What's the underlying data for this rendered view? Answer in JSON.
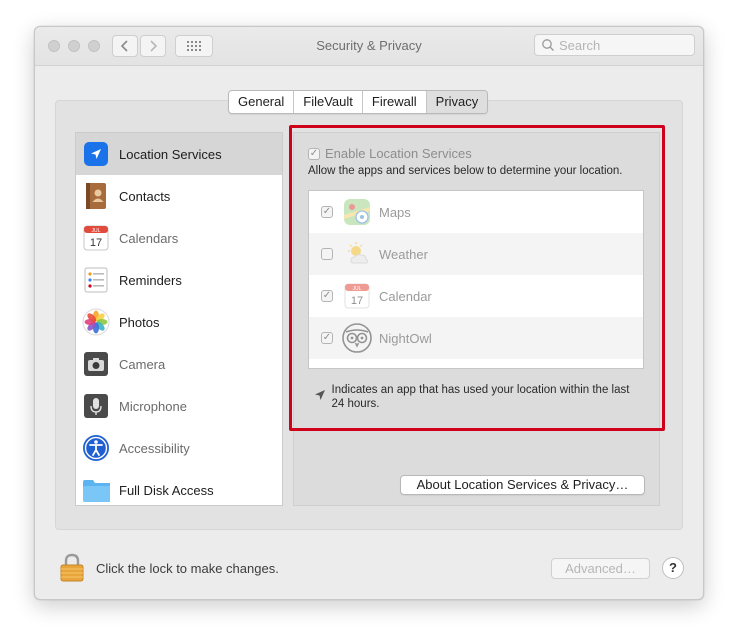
{
  "window": {
    "title": "Security & Privacy"
  },
  "search": {
    "placeholder": "Search",
    "value": ""
  },
  "tabs": [
    {
      "label": "General"
    },
    {
      "label": "FileVault"
    },
    {
      "label": "Firewall"
    },
    {
      "label": "Privacy",
      "selected": true
    }
  ],
  "sidebar": {
    "items": [
      {
        "label": "Location Services",
        "icon": "location-arrow-icon",
        "selected": true
      },
      {
        "label": "Contacts",
        "icon": "contacts-book-icon"
      },
      {
        "label": "Calendars",
        "icon": "calendar-icon",
        "dimmed": true
      },
      {
        "label": "Reminders",
        "icon": "reminders-icon"
      },
      {
        "label": "Photos",
        "icon": "photos-icon"
      },
      {
        "label": "Camera",
        "icon": "camera-icon",
        "dimmed": true
      },
      {
        "label": "Microphone",
        "icon": "microphone-icon",
        "dimmed": true
      },
      {
        "label": "Accessibility",
        "icon": "accessibility-icon",
        "dimmed": true
      },
      {
        "label": "Full Disk Access",
        "icon": "folder-icon"
      }
    ]
  },
  "location": {
    "enable_label": "Enable Location Services",
    "enable_checked": true,
    "description": "Allow the apps and services below to determine your location.",
    "apps": [
      {
        "name": "Maps",
        "checked": true,
        "icon": "maps-icon"
      },
      {
        "name": "Weather",
        "checked": false,
        "icon": "weather-icon"
      },
      {
        "name": "Calendar",
        "checked": true,
        "icon": "calendar-icon"
      },
      {
        "name": "NightOwl",
        "checked": true,
        "icon": "owl-icon"
      }
    ],
    "note": "Indicates an app that has used your location within the last 24 hours.",
    "about_button": "About Location Services & Privacy…"
  },
  "footer": {
    "lock_text": "Click the lock to make changes.",
    "advanced_button": "Advanced…",
    "help_button": "?"
  },
  "colors": {
    "highlight_outline": "#d0021b",
    "location_icon_bg": "#1a73e8",
    "lock_body": "#e8a53a"
  }
}
